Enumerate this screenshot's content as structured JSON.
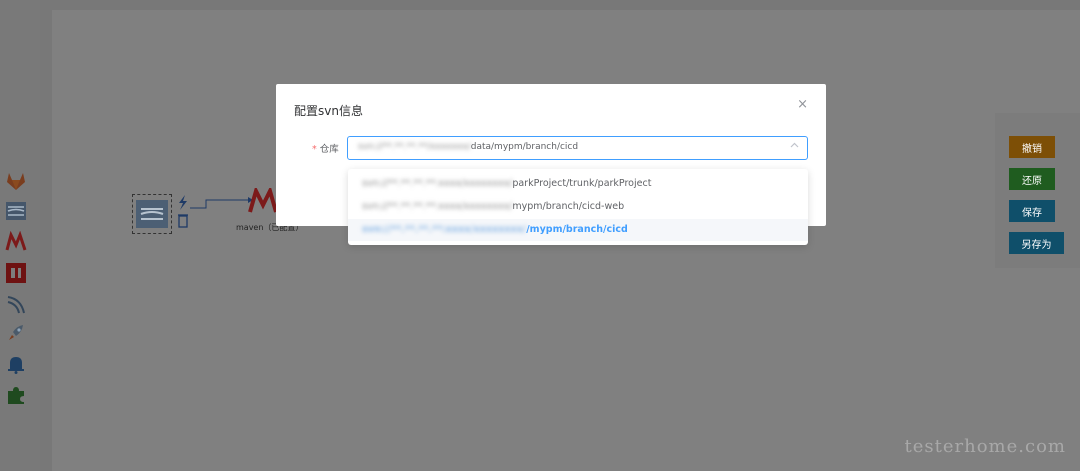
{
  "modal": {
    "title": "配置svn信息",
    "close_symbol": "×",
    "field": {
      "required_mark": "*",
      "label": "仓库",
      "value_prefix": "svn://**.**.**.**/xxxxxxx/",
      "value_suffix": "data/mypm/branch/cicd"
    },
    "dropdown": {
      "options": [
        {
          "prefix": "svn://**.**.**.**:xxxx/xxxxxxxx/",
          "suffix": "parkProject/trunk/parkProject",
          "selected": false
        },
        {
          "prefix": "svn://**.**.**.**:xxxx/xxxxxxxx/",
          "suffix": "mypm/branch/cicd-web",
          "selected": false
        },
        {
          "prefix": "svn://**.**.**.**:xxxx/xxxxxxxx/",
          "suffix": "/mypm/branch/cicd",
          "selected": true
        }
      ]
    }
  },
  "canvas": {
    "maven_label": "maven（已配置）"
  },
  "actions": {
    "cancel": "撤销",
    "restore": "还原",
    "save": "保存",
    "save_as": "另存为"
  },
  "watermark": "testerhome.com",
  "palette_icons": [
    "gitlab-icon",
    "svn-icon",
    "maven-icon",
    "npm-icon",
    "curl-icon",
    "deploy-rocket-icon",
    "notification-bell-icon",
    "plugin-puzzle-icon"
  ],
  "colors": {
    "accent": "#409eff",
    "required": "#f56c6c",
    "cancel_btn": "#7d4f06",
    "restore_btn": "#1f5c1f",
    "save_btn": "#0f4f6a"
  }
}
